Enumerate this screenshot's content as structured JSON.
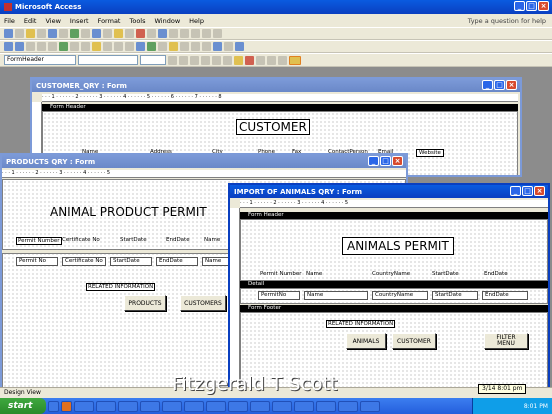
{
  "app": {
    "title": "Microsoft Access",
    "help_placeholder": "Type a question for help"
  },
  "menu": [
    "File",
    "Edit",
    "View",
    "Insert",
    "Format",
    "Tools",
    "Window",
    "Help"
  ],
  "format_bar": {
    "object_combo": "FormHeader"
  },
  "customer_window": {
    "title": "CUSTOMER_QRY : Form",
    "section_header": "Form Header",
    "heading": "CUSTOMER",
    "columns": [
      "Name",
      "Address",
      "City",
      "Phone",
      "Fax",
      "ContactPerson",
      "Email",
      "Website"
    ]
  },
  "products_window": {
    "title": "PRODUCTS QRY : Form",
    "heading": "ANIMAL PRODUCT PERMIT",
    "labels": [
      "Permit Number",
      "Certificate No",
      "StartDate",
      "EndDate",
      "Name"
    ],
    "fields": [
      "Permit No",
      "Certificate No",
      "StartDate",
      "EndDate",
      "Name"
    ],
    "related": "RELATED INFORMATION",
    "btn_products": "PRODUCTS",
    "btn_customers": "CUSTOMERS"
  },
  "animals_window": {
    "title": "IMPORT OF ANIMALS QRY : Form",
    "section_header": "Form Header",
    "section_detail": "Detail",
    "section_footer": "Form Footer",
    "heading": "ANIMALS PERMIT",
    "labels": [
      "Permit Number",
      "Name",
      "CountryName",
      "StartDate",
      "EndDate"
    ],
    "fields": [
      "PermitNo",
      "Name",
      "CountryName",
      "StartDate",
      "EndDate"
    ],
    "related": "RELATED INFORMATION",
    "btn_animals": "ANIMALS",
    "btn_customer": "CUSTOMER",
    "btn_filter": "FILTER\nMENU"
  },
  "status": {
    "text": "Design View"
  },
  "watermark": "Fitzgerald T Scott",
  "taskbar": {
    "start": "start",
    "tooltip": "3/14  8:01 pm",
    "clock": "8:01 PM"
  }
}
